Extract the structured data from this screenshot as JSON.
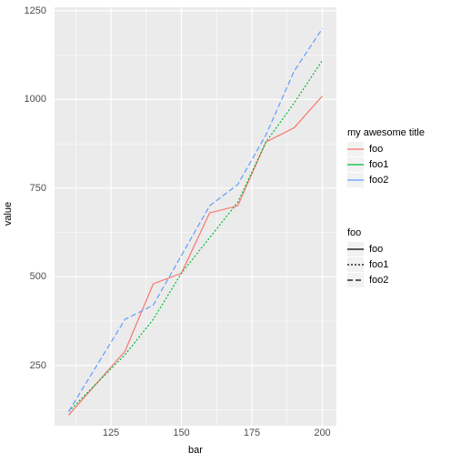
{
  "chart_data": {
    "type": "line",
    "xlabel": "bar",
    "ylabel": "value",
    "xlim": [
      105,
      205
    ],
    "ylim": [
      80,
      1260
    ],
    "x_ticks": [
      125,
      150,
      175,
      200
    ],
    "y_ticks": [
      250,
      500,
      750,
      1000,
      1250
    ],
    "x_minor": [
      112.5,
      137.5,
      162.5,
      187.5
    ],
    "y_minor": [
      125,
      375,
      625,
      875,
      1125
    ],
    "x": [
      110,
      120,
      130,
      140,
      150,
      160,
      170,
      180,
      190,
      200
    ],
    "series": [
      {
        "name": "foo",
        "color": "#F8766D",
        "dash": "",
        "values": [
          110,
          200,
          290,
          480,
          510,
          680,
          700,
          880,
          920,
          1010
        ]
      },
      {
        "name": "foo1",
        "color": "#00BA38",
        "dash": "2 2",
        "values": [
          120,
          200,
          280,
          380,
          510,
          610,
          710,
          880,
          990,
          1110
        ]
      },
      {
        "name": "foo2",
        "color": "#619CFF",
        "dash": "6 3",
        "values": [
          120,
          250,
          380,
          420,
          560,
          700,
          760,
          900,
          1080,
          1200
        ]
      }
    ],
    "legends": {
      "color": {
        "title": "my awesome title",
        "items": [
          "foo",
          "foo1",
          "foo2"
        ]
      },
      "linetype": {
        "title": "foo",
        "items": [
          "foo",
          "foo1",
          "foo2"
        ]
      }
    }
  }
}
